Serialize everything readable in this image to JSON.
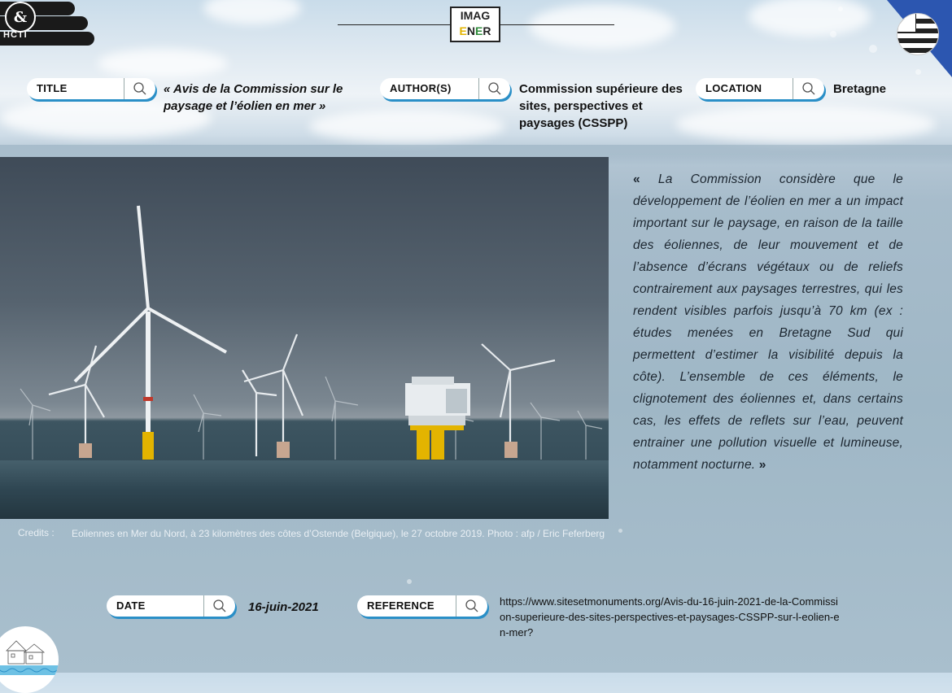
{
  "logo": {
    "text": "HCTI",
    "mark": "&"
  },
  "brand": {
    "line1": "IMAG",
    "line2_e": "E",
    "line2_n": "N",
    "line2_e2": "E",
    "line2_r": "R"
  },
  "fields": {
    "title": {
      "label": "TITLE",
      "value": "« Avis de la Commission sur le paysage et l’éolien en mer »"
    },
    "authors": {
      "label": "AUTHOR(S)",
      "value": "Commission supérieure des sites, perspectives et paysages (CSSPP)"
    },
    "location": {
      "label": "LOCATION",
      "value": "Bretagne"
    },
    "date": {
      "label": "DATE",
      "value": "16-juin-2021"
    },
    "reference": {
      "label": "REFERENCE",
      "value": "https://www.sitesetmonuments.org/Avis-du-16-juin-2021-de-la-Commission-superieure-des-sites-perspectives-et-paysages-CSSPP-sur-l-eolien-en-mer?"
    }
  },
  "quote": {
    "open": "«",
    "text": " La Commission considère que le développement de l’éolien en mer a un impact important sur le paysage, en raison de la taille des éoliennes, de leur mouvement et de l’absence d’écrans végétaux ou de reliefs contrairement aux paysages terrestres, qui les rendent visibles parfois jusqu’à 70 km (ex : études menées en Bretagne Sud qui permettent d’estimer la visibilité depuis la côte). L’ensemble de ces éléments, le clignotement des éoliennes et, dans certains cas, les effets de reflets sur l’eau, peuvent entrainer une pollution visuelle et lumineuse, notamment nocturne. ",
    "close": "»"
  },
  "credits": {
    "label": "Credits :",
    "text": "Eoliennes en Mer du Nord, à 23 kilomètres des côtes d’Ostende (Belgique), le 27 octobre 2019. Photo : afp / Eric Feferberg"
  },
  "colors": {
    "accent": "#2a8fc7",
    "brand_yellow": "#e3b400",
    "brand_green": "#2e8b3a"
  }
}
